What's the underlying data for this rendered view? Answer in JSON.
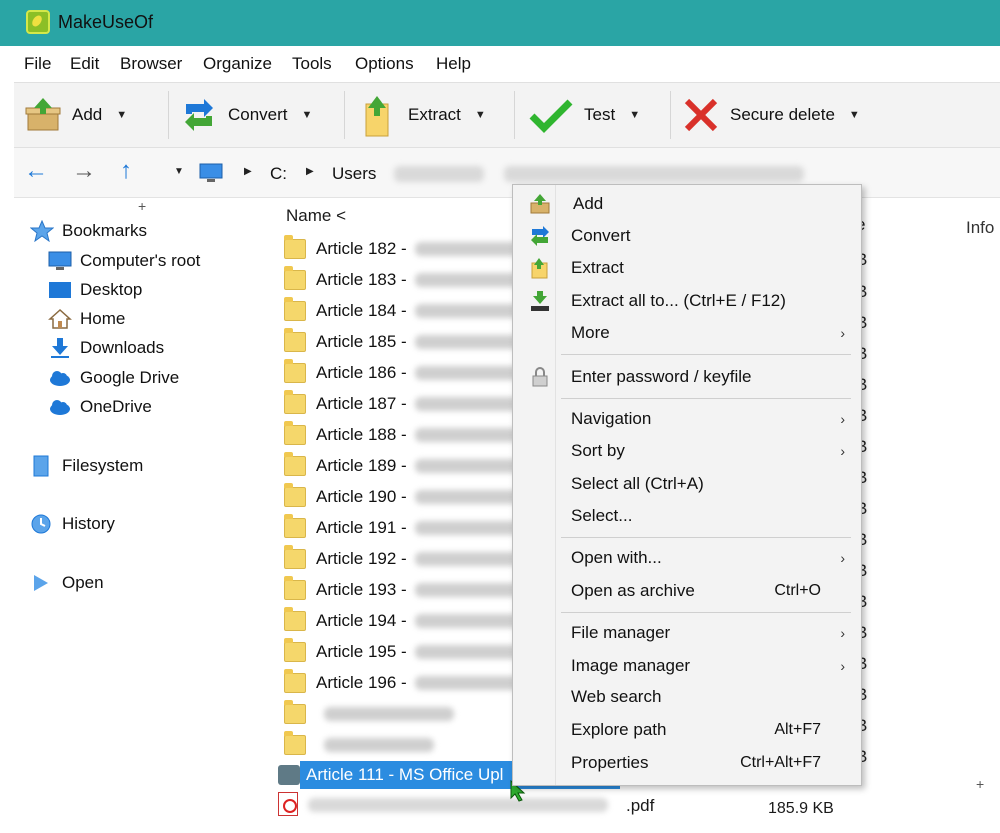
{
  "window": {
    "title": "MakeUseOf"
  },
  "menubar": {
    "items": [
      "File",
      "Edit",
      "Browser",
      "Organize",
      "Tools",
      "Options",
      "Help"
    ]
  },
  "toolbar": {
    "add_label": "Add",
    "convert_label": "Convert",
    "extract_label": "Extract",
    "test_label": "Test",
    "secure_delete_label": "Secure delete"
  },
  "addressbar": {
    "crumbs": [
      "C:",
      "Users"
    ]
  },
  "sidebar": {
    "bookmarks_label": "Bookmarks",
    "items": [
      "Computer's root",
      "Desktop",
      "Home",
      "Downloads",
      "Google Drive",
      "OneDrive"
    ],
    "filesystem_label": "Filesystem",
    "history_label": "History",
    "open_label": "Open"
  },
  "filelist": {
    "name_header": "Name <",
    "info_header": "Info",
    "rows": [
      "Article 182 -",
      "Article 183 -",
      "Article 184 -",
      "Article 185 -",
      "Article 186 -",
      "Article 187 -",
      "Article 188 -",
      "Article 189 -",
      "Article 190 -",
      "Article 191 -",
      "Article 192 -",
      "Article 193 -",
      "Article 194 -",
      "Article 195 -",
      "Article 196 -"
    ],
    "selected_row": "Article 111 - MS Office Upl",
    "pdf_ext": ".pdf",
    "pdf_size": "185.9 KB",
    "size_unit": "B"
  },
  "context_menu": {
    "add": "Add",
    "convert": "Convert",
    "extract": "Extract",
    "extract_all": "Extract all to... (Ctrl+E / F12)",
    "more": "More",
    "enter_password": "Enter password / keyfile",
    "navigation": "Navigation",
    "sort_by": "Sort by",
    "select_all": "Select all (Ctrl+A)",
    "select": "Select...",
    "open_with": "Open with...",
    "open_as_archive": "Open as archive",
    "open_as_archive_shortcut": "Ctrl+O",
    "file_manager": "File manager",
    "image_manager": "Image manager",
    "web_search": "Web search",
    "explore_path": "Explore path",
    "explore_path_shortcut": "Alt+F7",
    "properties": "Properties",
    "properties_shortcut": "Ctrl+Alt+F7"
  },
  "colors": {
    "titlebar": "#2aa5a5",
    "selection": "#2b8ce0",
    "accent_blue": "#1e78d7"
  }
}
